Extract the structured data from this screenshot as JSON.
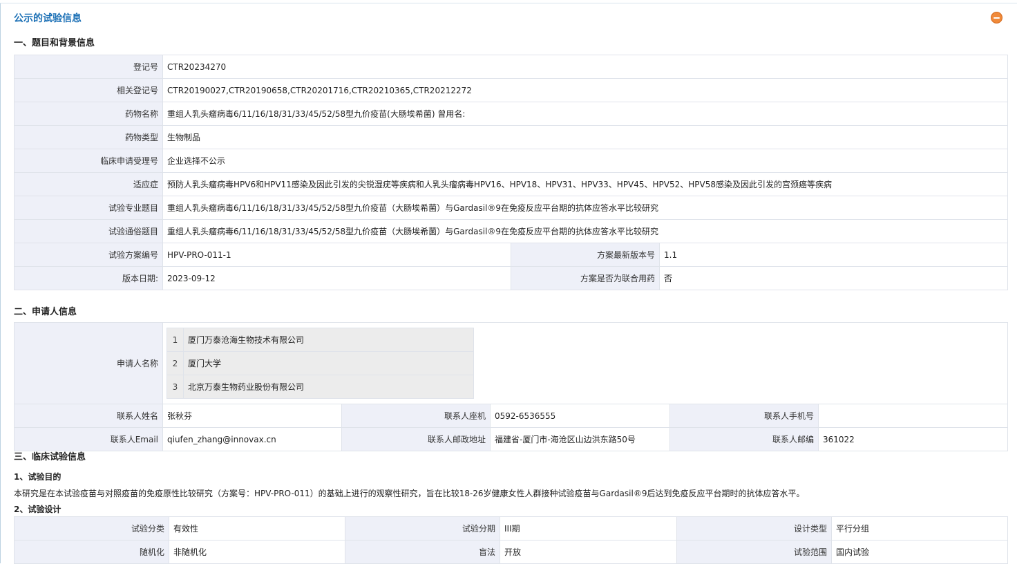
{
  "page_title": "公示的试验信息",
  "section1": {
    "heading": "一、题目和背景信息",
    "rows": [
      {
        "label": "登记号",
        "value": "CTR20234270"
      },
      {
        "label": "相关登记号",
        "value": "CTR20190027,CTR20190658,CTR20201716,CTR20210365,CTR20212272"
      },
      {
        "label": "药物名称",
        "value": "重组人乳头瘤病毒6/11/16/18/31/33/45/52/58型九价疫苗(大肠埃希菌)  曾用名:"
      },
      {
        "label": "药物类型",
        "value": "生物制品"
      },
      {
        "label": "临床申请受理号",
        "value": "企业选择不公示"
      },
      {
        "label": "适应症",
        "value": "预防人乳头瘤病毒HPV6和HPV11感染及因此引发的尖锐湿疣等疾病和人乳头瘤病毒HPV16、HPV18、HPV31、HPV33、HPV45、HPV52、HPV58感染及因此引发的宫颈癌等疾病"
      },
      {
        "label": "试验专业题目",
        "value": "重组人乳头瘤病毒6/11/16/18/31/33/45/52/58型九价疫苗（大肠埃希菌）与Gardasil®9在免疫反应平台期的抗体应答水平比较研究"
      },
      {
        "label": "试验通俗题目",
        "value": "重组人乳头瘤病毒6/11/16/18/31/33/45/52/58型九价疫苗（大肠埃希菌）与Gardasil®9在免疫反应平台期的抗体应答水平比较研究"
      }
    ],
    "protocol_no": {
      "label": "试验方案编号",
      "value": "HPV-PRO-011-1"
    },
    "latest_version": {
      "label": "方案最新版本号",
      "value": "1.1"
    },
    "version_date": {
      "label": "版本日期:",
      "value": "2023-09-12"
    },
    "combination": {
      "label": "方案是否为联合用药",
      "value": "否"
    }
  },
  "section2": {
    "heading": "二、申请人信息",
    "applicant_label": "申请人名称",
    "applicants": [
      {
        "no": "1",
        "name": "厦门万泰沧海生物技术有限公司"
      },
      {
        "no": "2",
        "name": "厦门大学"
      },
      {
        "no": "3",
        "name": "北京万泰生物药业股份有限公司"
      }
    ],
    "contact_name": {
      "label": "联系人姓名",
      "value": "张秋芬"
    },
    "contact_phone": {
      "label": "联系人座机",
      "value": "0592-6536555"
    },
    "contact_mobile": {
      "label": "联系人手机号",
      "value": ""
    },
    "contact_email": {
      "label": "联系人Email",
      "value": "qiufen_zhang@innovax.cn"
    },
    "contact_address": {
      "label": "联系人邮政地址",
      "value": "福建省-厦门市-海沧区山边洪东路50号"
    },
    "contact_zip": {
      "label": "联系人邮编",
      "value": "361022"
    }
  },
  "section3": {
    "heading": "三、临床试验信息",
    "purpose_heading": "1、试验目的",
    "purpose_text": "本研究是在本试验疫苗与对照疫苗的免疫原性比较研究（方案号：HPV-PRO-011）的基础上进行的观察性研究，旨在比较18-26岁健康女性人群接种试验疫苗与Gardasil®9后达到免疫反应平台期时的抗体应答水平。",
    "design_heading": "2、试验设计",
    "design": {
      "category": {
        "label": "试验分类",
        "value": "有效性"
      },
      "phase": {
        "label": "试验分期",
        "value": "III期"
      },
      "design_type": {
        "label": "设计类型",
        "value": "平行分组"
      },
      "randomization": {
        "label": "随机化",
        "value": "非随机化"
      },
      "blinding": {
        "label": "盲法",
        "value": "开放"
      },
      "scope": {
        "label": "试验范围",
        "value": "国内试验"
      }
    }
  },
  "colors": {
    "title": "#1a6fb5",
    "label_bg": "#eef0f8",
    "border": "#dfe3ea",
    "collapse_icon": "#f08a3a"
  }
}
